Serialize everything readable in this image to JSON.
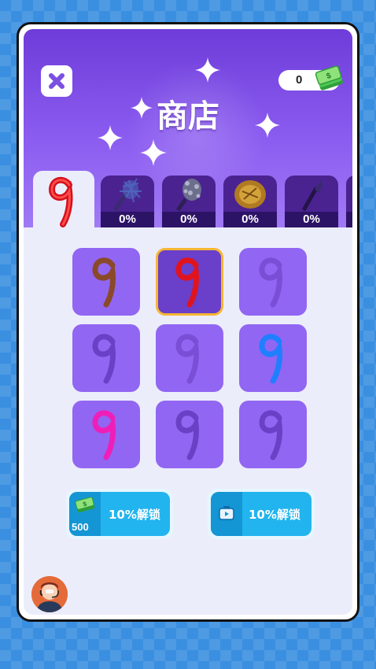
{
  "shop": {
    "title": "商店",
    "currency_amount": "0",
    "currency_icon": "cash-stack-icon"
  },
  "tabs": [
    {
      "kind": "nine-red",
      "active": true
    },
    {
      "kind": "spiky-blue-weapon",
      "progress": "0%"
    },
    {
      "kind": "spiked-club",
      "progress": "0%"
    },
    {
      "kind": "golden-shield",
      "progress": "0%"
    },
    {
      "kind": "torch",
      "progress": "0%"
    }
  ],
  "skins": [
    {
      "color": "#8a4a2a",
      "state": "owned"
    },
    {
      "color": "#e0141e",
      "state": "selected"
    },
    {
      "color": "#7a4fd6",
      "state": "locked"
    },
    {
      "color": "#6a41c6",
      "state": "locked"
    },
    {
      "color": "#7a4fd6",
      "state": "locked"
    },
    {
      "color": "#1f7fff",
      "state": "owned"
    },
    {
      "color": "#ee1fb8",
      "state": "owned"
    },
    {
      "color": "#6a41c6",
      "state": "locked"
    },
    {
      "color": "#6a41c6",
      "state": "locked"
    }
  ],
  "actions": {
    "cash_unlock": {
      "price": "500",
      "label": "10%解锁",
      "icon": "cash-stack-icon"
    },
    "ad_unlock": {
      "label": "10%解锁",
      "icon": "video-ad-icon"
    }
  },
  "colors": {
    "header_top": "#6e3cd9",
    "cell_bg": "#9166f2",
    "selected_border": "#f5b632",
    "button_blue": "#22b4ee"
  }
}
